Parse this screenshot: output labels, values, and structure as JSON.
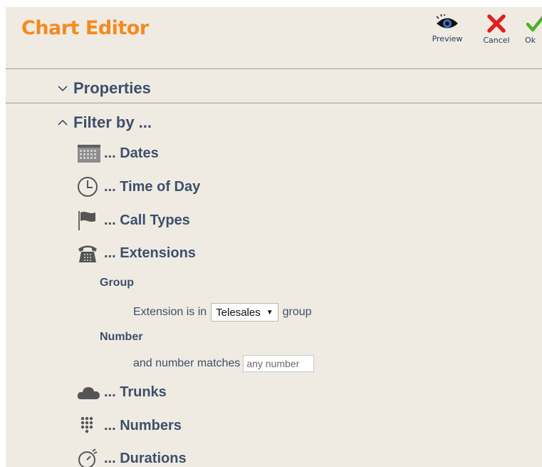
{
  "header": {
    "title": "Chart Editor",
    "buttons": [
      {
        "label": "Preview",
        "icon": "eye-icon"
      },
      {
        "label": "Cancel",
        "icon": "close-icon"
      },
      {
        "label": "Ok",
        "icon": "checkmark-icon"
      }
    ]
  },
  "sections": {
    "properties": {
      "label": "Properties",
      "state": "collapsed"
    },
    "filter": {
      "label": "Filter by ...",
      "state": "expanded"
    }
  },
  "filters": [
    {
      "label": "... Dates",
      "icon": "calendar-icon"
    },
    {
      "label": "... Time of Day",
      "icon": "clock-icon"
    },
    {
      "label": "... Call Types",
      "icon": "flag-icon"
    },
    {
      "label": "... Extensions",
      "icon": "telephone-icon"
    },
    {
      "label": "... Trunks",
      "icon": "cloud-icon"
    },
    {
      "label": "... Numbers",
      "icon": "keypad-icon"
    },
    {
      "label": "... Durations",
      "icon": "stopwatch-icon"
    }
  ],
  "extensions": {
    "group_heading": "Group",
    "group_prefix": "Extension is in",
    "group_value": "Telesales",
    "group_suffix": "group",
    "number_heading": "Number",
    "number_prefix": "and number matches",
    "number_placeholder": "any number"
  },
  "colors": {
    "title": "#f58a1f",
    "text": "#3d4f6a",
    "panel_background": "#efebe3",
    "cancel": "#e02020",
    "ok": "#4caf2a"
  }
}
